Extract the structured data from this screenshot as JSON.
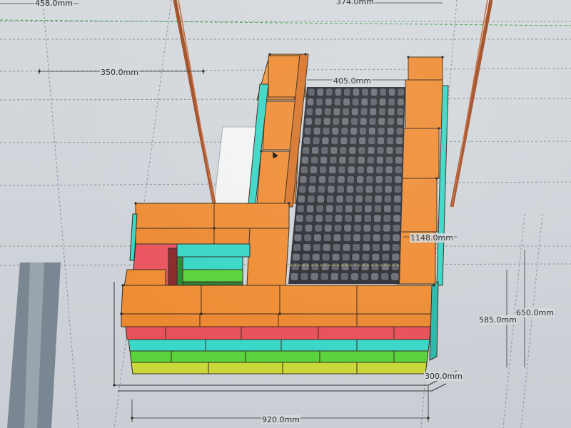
{
  "app": {
    "view": "3D modeling viewport"
  },
  "dimensions": {
    "d458": "458.0mm",
    "d374": "374.0mm",
    "d350": "350.0mm",
    "d405": "405.0mm",
    "d1148": "1148.0mm",
    "d650": "650.0mm",
    "d585": "585.0mm",
    "d300": "300.0mm",
    "d920": "920.0mm"
  },
  "colors": {
    "orange": "#ee8a2f",
    "red": "#e8515a",
    "cyan": "#39d8c8",
    "green": "#5ad33c",
    "yellow": "#c9d93a",
    "grid": "#5d6068",
    "rod": "#b95a2a"
  }
}
